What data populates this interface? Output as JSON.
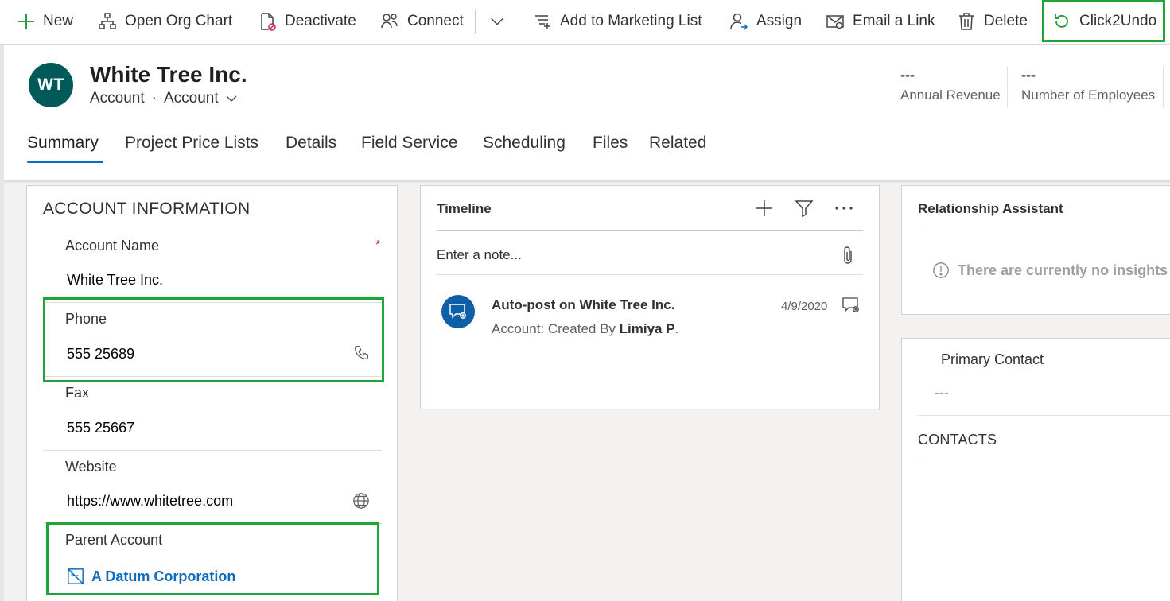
{
  "command_bar": {
    "new_label": "New",
    "org_chart_label": "Open Org Chart",
    "deactivate_label": "Deactivate",
    "connect_label": "Connect",
    "marketing_label": "Add to Marketing List",
    "assign_label": "Assign",
    "email_link_label": "Email a Link",
    "delete_label": "Delete",
    "click2undo_label": "Click2Undo"
  },
  "header": {
    "avatar_initials": "WT",
    "title": "White Tree Inc.",
    "entity_type": "Account",
    "form_name": "Account",
    "annual_revenue_value": "---",
    "annual_revenue_label": "Annual Revenue",
    "employees_value": "---",
    "employees_label": "Number of Employees"
  },
  "tabs": [
    {
      "label": "Summary"
    },
    {
      "label": "Project Price Lists"
    },
    {
      "label": "Details"
    },
    {
      "label": "Field Service"
    },
    {
      "label": "Scheduling"
    },
    {
      "label": "Files"
    },
    {
      "label": "Related"
    }
  ],
  "account_info": {
    "section_title": "ACCOUNT INFORMATION",
    "account_name_label": "Account Name",
    "required_marker": "*",
    "account_name_value": "White Tree Inc.",
    "phone_label": "Phone",
    "phone_value": "555 25689",
    "fax_label": "Fax",
    "fax_value": "555 25667",
    "website_label": "Website",
    "website_value": "https://www.whitetree.com",
    "parent_account_label": "Parent Account",
    "parent_account_value": "A Datum Corporation"
  },
  "timeline": {
    "title": "Timeline",
    "note_placeholder": "Enter a note...",
    "post_title": "Auto-post on White Tree Inc.",
    "post_sub_prefix": "Account: Created By ",
    "post_author": "Limiya P",
    "post_sub_suffix": ".",
    "post_date": "4/9/2020"
  },
  "relationship_assistant": {
    "title": "Relationship Assistant",
    "empty_text": "There are currently no insights"
  },
  "primary_contact": {
    "label": "Primary Contact",
    "value": "---",
    "contacts_title": "CONTACTS"
  },
  "colors": {
    "accent": "#0f6cbd",
    "highlight": "#22a33a",
    "avatar_bg": "#005a5a"
  }
}
